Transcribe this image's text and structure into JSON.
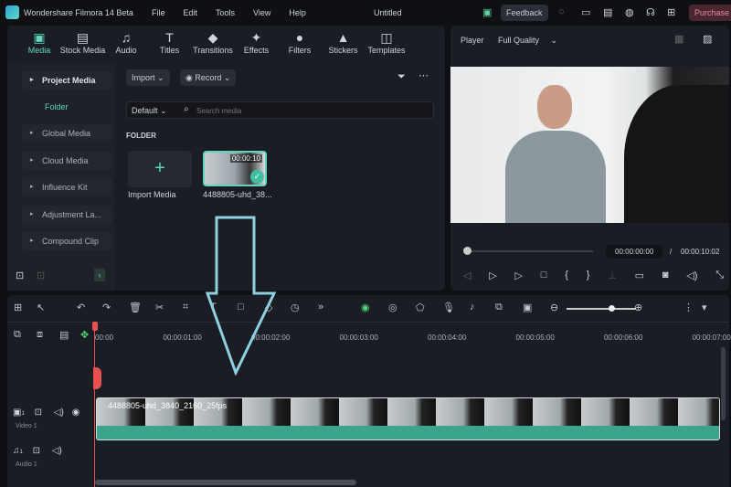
{
  "app": {
    "title": "Wondershare Filmora 14 Beta",
    "doc_title": "Untitled",
    "menu": [
      "File",
      "Edit",
      "Tools",
      "View",
      "Help"
    ],
    "feedback": "Feedback",
    "purchase": "Purchase"
  },
  "tabs": [
    {
      "label": "Media",
      "icon": "media-icon",
      "glyph": "▣"
    },
    {
      "label": "Stock Media",
      "icon": "stock-media-icon",
      "glyph": "▤"
    },
    {
      "label": "Audio",
      "icon": "audio-icon",
      "glyph": "♫"
    },
    {
      "label": "Titles",
      "icon": "titles-icon",
      "glyph": "T"
    },
    {
      "label": "Transitions",
      "icon": "transitions-icon",
      "glyph": "◆"
    },
    {
      "label": "Effects",
      "icon": "effects-icon",
      "glyph": "✦"
    },
    {
      "label": "Filters",
      "icon": "filters-icon",
      "glyph": "●"
    },
    {
      "label": "Stickers",
      "icon": "stickers-icon",
      "glyph": "▲"
    },
    {
      "label": "Templates",
      "icon": "templates-icon",
      "glyph": "◫"
    }
  ],
  "sidebar": {
    "project_media": "Project Media",
    "folder": "Folder",
    "items": [
      "Global Media",
      "Cloud Media",
      "Influence Kit",
      "Adjustment La...",
      "Compound Clip"
    ]
  },
  "media": {
    "import": "Import",
    "record": "Record",
    "sort": "Default",
    "search_placeholder": "Search media",
    "section": "FOLDER",
    "import_media": "Import Media",
    "clip_name": "4488805-uhd_38...",
    "clip_duration": "00:00:10"
  },
  "player": {
    "label": "Player",
    "quality": "Full Quality",
    "current_time": "00:00:00:00",
    "total_time": "00:00:10:02",
    "progress": 0
  },
  "timeline": {
    "ruler": [
      "00:00",
      "00:00:01:00",
      "00:00:02:00",
      "00:00:03:00",
      "00:00:04:00",
      "00:00:05:00",
      "00:00:06:00",
      "00:00:07:00"
    ],
    "video_track": "Video 1",
    "audio_track": "Audio 1",
    "clip_label": "4488805-uhd_3840_2160_25fps",
    "track_num": "1",
    "zoom_level": 0.8
  }
}
